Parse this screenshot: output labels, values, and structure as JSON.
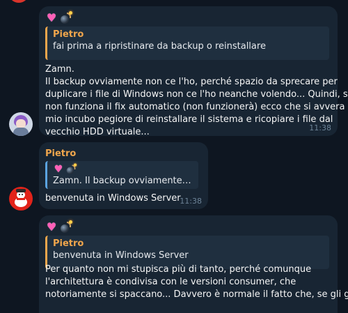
{
  "messages": [
    {
      "quote": {
        "name": "Pietro",
        "text": "fai prima a ripristinare da backup o reinstallare"
      },
      "text_lines": [
        "Zamn.",
        "Il backup ovviamente non ce l'ho, perché spazio da sprecare per",
        "duplicare i file di Windows non ce l'ho neanche volendo... Quindi, se",
        "non funziona il fix automatico (non funzionerà) ecco che si avvera il",
        "mio incubo pegiore di reinstallare il sistema e ricopiare i file dal",
        "vecchio HDD virtuale..."
      ],
      "time": "11:38"
    },
    {
      "sender": "Pietro",
      "quote": {
        "text": "Zamn. Il backup ovviamente no..."
      },
      "text": "benvenuta in Windows Server",
      "time": "11:38"
    },
    {
      "quote": {
        "name": "Pietro",
        "text": "benvenuta in Windows Server"
      },
      "text_lines": [
        "Per quanto non mi stupisca più di tanto, perché comunque",
        "l'architettura è condivisa con le versioni consumer, che",
        "notoriamente si spaccano... Davvero è normale il fatto che, se gli gira,"
      ]
    }
  ],
  "icons": {
    "sticker_heart": "sparkling-heart-emoji",
    "sticker_bomb": "bomb-emoji"
  },
  "colors": {
    "background": "#0e1621",
    "bubble": "#182533",
    "accent_name": "#f0a64c",
    "reply_bar_blue": "#5aa3e0"
  }
}
